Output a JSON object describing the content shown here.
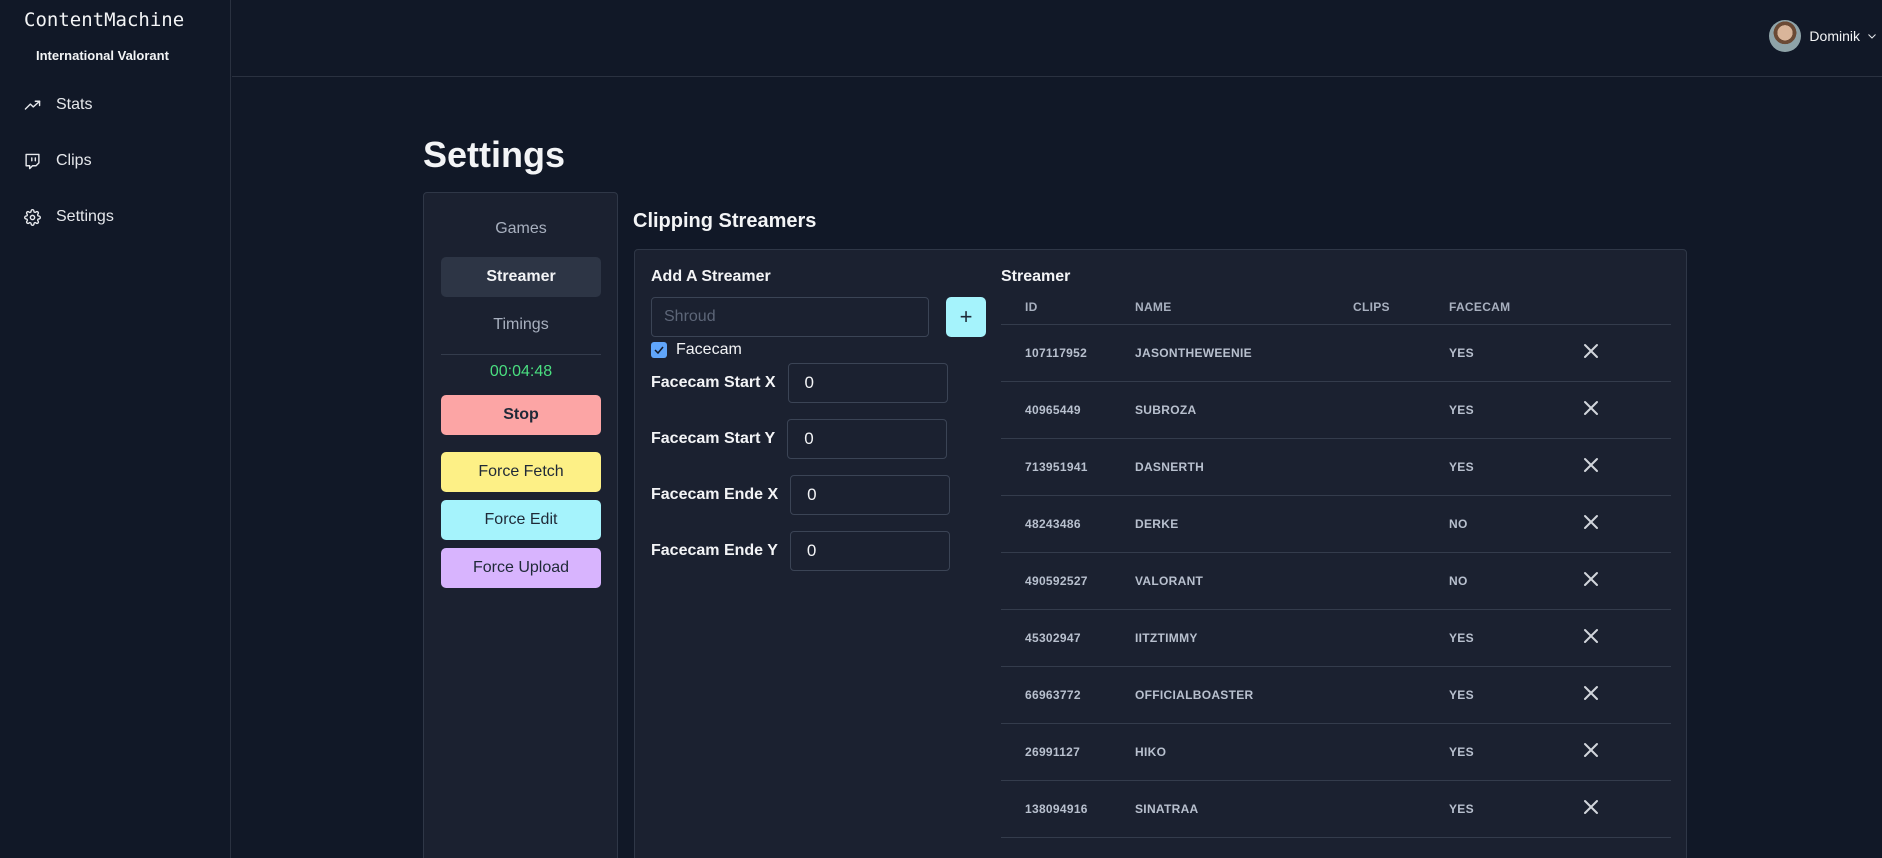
{
  "sidebar": {
    "brand": "ContentMachine",
    "workspace": "International Valorant",
    "items": [
      {
        "label": "Stats",
        "icon": "trending-up-icon"
      },
      {
        "label": "Clips",
        "icon": "twitch-icon"
      },
      {
        "label": "Settings",
        "icon": "gear-icon"
      }
    ]
  },
  "header": {
    "user_name": "Dominik"
  },
  "page": {
    "title": "Settings"
  },
  "settings_menu": {
    "items": [
      {
        "label": "Games"
      },
      {
        "label": "Streamer",
        "active": true
      },
      {
        "label": "Timings"
      }
    ],
    "timer": "00:04:48",
    "stop_label": "Stop",
    "force_fetch_label": "Force Fetch",
    "force_edit_label": "Force Edit",
    "force_upload_label": "Force Upload"
  },
  "clipping": {
    "section_title": "Clipping Streamers",
    "add_label": "Add A Streamer",
    "input_placeholder": "Shroud",
    "input_value": "",
    "add_button": "+",
    "facecam_label": "Facecam",
    "facecam_checked": true,
    "fields": [
      {
        "label": "Facecam Start X",
        "value": "0"
      },
      {
        "label": "Facecam Start Y",
        "value": "0"
      },
      {
        "label": "Facecam Ende X",
        "value": "0"
      },
      {
        "label": "Facecam Ende Y",
        "value": "0"
      }
    ]
  },
  "streamer_list": {
    "title": "Streamer",
    "columns": [
      "ID",
      "NAME",
      "CLIPS",
      "FACECAM"
    ],
    "rows": [
      {
        "id": "107117952",
        "name": "JASONTHEWEENIE",
        "clips": "",
        "facecam": "YES"
      },
      {
        "id": "40965449",
        "name": "SUBROZA",
        "clips": "",
        "facecam": "YES"
      },
      {
        "id": "713951941",
        "name": "DASNERTH",
        "clips": "",
        "facecam": "YES"
      },
      {
        "id": "48243486",
        "name": "DERKE",
        "clips": "",
        "facecam": "NO"
      },
      {
        "id": "490592527",
        "name": "VALORANT",
        "clips": "",
        "facecam": "NO"
      },
      {
        "id": "45302947",
        "name": "IITZTIMMY",
        "clips": "",
        "facecam": "YES"
      },
      {
        "id": "66963772",
        "name": "OFFICIALBOASTER",
        "clips": "",
        "facecam": "YES"
      },
      {
        "id": "26991127",
        "name": "HIKO",
        "clips": "",
        "facecam": "YES"
      },
      {
        "id": "138094916",
        "name": "SINATRAA",
        "clips": "",
        "facecam": "YES"
      }
    ]
  }
}
